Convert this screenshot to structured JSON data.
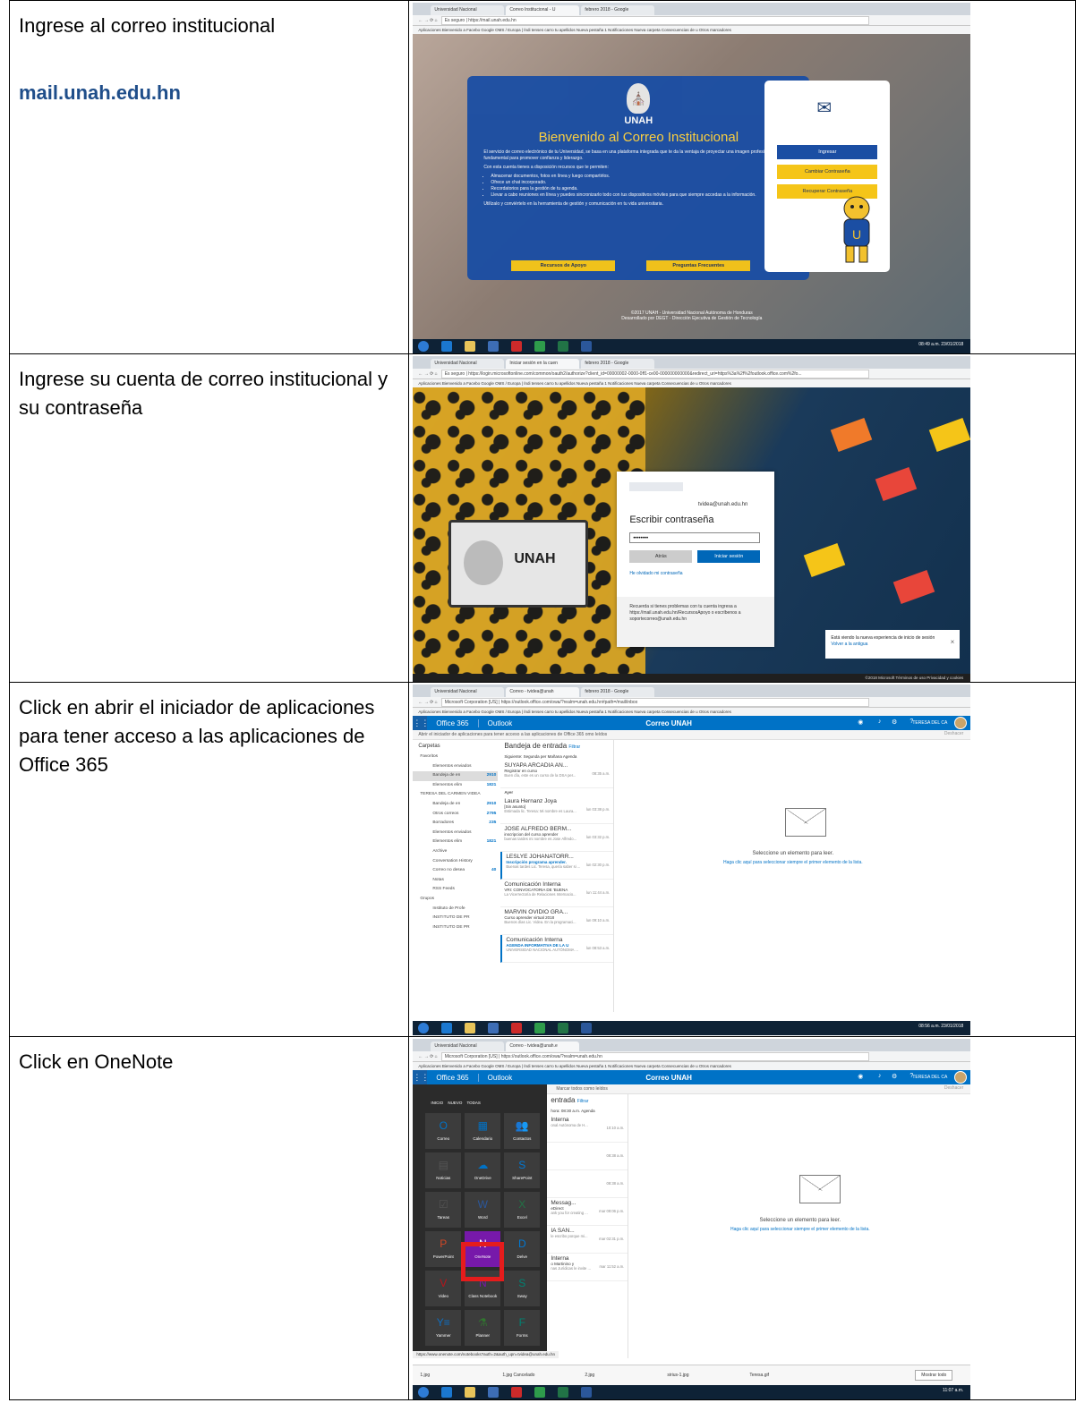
{
  "rows": [
    {
      "instruction": "Ingrese al correo institucional",
      "url_text": "mail.unah.edu.hn",
      "shot": {
        "tabs": [
          "Universidad Nacional",
          "Correo Institucional - U",
          "febrero 2018 - Google"
        ],
        "address": "Es seguro | https://mail.unah.edu.hn",
        "bookmarks": "Aplicaciones  Bienvenido a Facebo  Google  OMS / Europa | Índi  tenses  carro  tu apellidos  Nueva pestaña  1 Notificaciones  Nueva carpeta  Consecuencias de u  Otros marcadores",
        "seal_name": "UNAH",
        "title": "Bienvenido al Correo Institucional",
        "intro": "El servicio de correo electrónico de tu Universidad, se basa en una plataforma integrada que te da la ventaja de proyectar una imagen profesional, fundamental para promover confianza y liderazgo.",
        "list_intro": "Con esta cuenta tienes a disposición recursos que te permiten:",
        "bullets": [
          "Almacenar documentos, fotos en línea y luego compartirlos.",
          "Ofrece un chat incorporado.",
          "Recordatorios para la gestión de tu agenda.",
          "Llevar a cabo reuniones en línea y puedes sincronizarlo todo con tus dispositivos móviles para que siempre accedas a la información."
        ],
        "closing": "Utilízalo y conviértelo en la herramienta de gestión y comunicación en tu vida universitaria.",
        "btn_resources": "Recursos de Apoyo",
        "btn_faq": "Preguntas Frecuentes",
        "btn_login": "Ingresar",
        "btn_change": "Cambiar Contraseña",
        "btn_recover": "Recuperar Contraseña",
        "footer_1": "©2017 UNAH - Universidad Nacional Autónoma de Honduras",
        "footer_2": "Desarrollado por DEGT - Dirección Ejecutiva de Gestión de Tecnología",
        "clock": "08:49 a.m. 23/01/2018"
      }
    },
    {
      "instruction": "Ingrese su cuenta de correo institucional y su contraseña",
      "shot": {
        "tabs": [
          "Universidad Nacional",
          "Iniciar sesión en la cuen",
          "febrero 2018 - Google"
        ],
        "address": "Es seguro | https://login.microsoftonline.com/common/oauth2/authorize?client_id=00000002-0000-0ff1-ce00-000000000000&redirect_uri=https%3a%2f%2foutlook.office.com%2fo...",
        "bookmarks": "Aplicaciones  Bienvenido a Facebo  Google  OMS / Europa | Índi  tenses  carro  tu apellidos  Nueva pestaña  1 Notificaciones  Nueva carpeta  Consecuencias de u  Otros marcadores",
        "laptop_label": "UNAH",
        "email": "tvidea@unah.edu.hn",
        "heading": "Escribir contraseña",
        "password": "••••••••",
        "btn_back": "Atrás",
        "btn_signin": "Iniciar sesión",
        "forgot": "He olvidado mi contraseña",
        "note": "Recuerda si tienes problemas con tu cuenta ingresa a https://mail.unah.edu.hn/RecursosApoyo o escríbenos a soportecorreo@unah.edu.hn",
        "toast_1": "Está viendo la nueva experiencia de inicio de sesión",
        "toast_2": "Volver a la antigua",
        "footer": "©2018 Microsoft    Términos de uso    Privacidad y cookies"
      }
    },
    {
      "instruction": "Click en abrir el iniciador de aplicaciones para tener acceso a las aplicaciones de Office 365",
      "shot": {
        "tabs": [
          "Universidad Nacional",
          "Correo - tvidea@unah",
          "febrero 2018 - Google"
        ],
        "address": "Microsoft Corporation [US] | https://outlook.office.com/owa/?realm=unah.edu.hn#path=/mail/inbox",
        "bookmarks": "Aplicaciones  Bienvenido a Facebo  Google  OMS / Europa | Índi  tenses  carro  tu apellidos  Nueva pestaña  1 Notificaciones  Nueva carpeta  Consecuencias de u  Otros marcadores",
        "brand": "Office 365",
        "app": "Outlook",
        "center": "Correo UNAH",
        "user": "TERESA DEL CA",
        "tooltip": "Abrir el iniciador de aplicaciones para tener acceso a las aplicaciones de Office 365 omo leídos",
        "undo": "Deshacer",
        "folders": [
          {
            "label": "Carpetas",
            "count": "",
            "cls": "top"
          },
          {
            "label": "Favoritos",
            "count": "",
            "cls": "head"
          },
          {
            "label": "Elementos enviados",
            "count": "",
            "cls": ""
          },
          {
            "label": "Bandeja de en",
            "count": "2910",
            "cls": "sel"
          },
          {
            "label": "Elementos elim",
            "count": "1821",
            "cls": ""
          },
          {
            "label": "TERESA DEL CARMEN VIDEA",
            "count": "",
            "cls": "head"
          },
          {
            "label": "Bandeja de en",
            "count": "2910",
            "cls": ""
          },
          {
            "label": "Otros correos",
            "count": "2795",
            "cls": ""
          },
          {
            "label": "Borradores",
            "count": "235",
            "cls": ""
          },
          {
            "label": "Elementos enviados",
            "count": "",
            "cls": ""
          },
          {
            "label": "Elementos elim",
            "count": "1821",
            "cls": ""
          },
          {
            "label": "Archive",
            "count": "",
            "cls": ""
          },
          {
            "label": "Conversation History",
            "count": "",
            "cls": ""
          },
          {
            "label": "Correo no desea",
            "count": "40",
            "cls": ""
          },
          {
            "label": "Notas",
            "count": "",
            "cls": ""
          },
          {
            "label": "RSS Feeds",
            "count": "",
            "cls": ""
          },
          {
            "label": "Grupos",
            "count": "",
            "cls": "head"
          },
          {
            "label": "Instituto de Profe",
            "count": "",
            "cls": ""
          },
          {
            "label": "INSTITUTO DE PR",
            "count": "",
            "cls": ""
          },
          {
            "label": "INSTITUTO DE PR",
            "count": "",
            "cls": ""
          }
        ],
        "list_title": "Bandeja de entrada",
        "filter": "Filtrar",
        "list_sub": "Siguiente: Segunda per    Mañana  Agenda",
        "day_label": "Ayer",
        "mails": [
          {
            "from": "SUYAPA ARCADIA AN...",
            "subj": "Registrar en curso",
            "prev": "Buen día, este es un curso de la DSA per...",
            "when": "08:35 a.m.",
            "unread": false
          },
          {
            "from": "Laura Hernanz Joya",
            "subj": "[Sin asunto]",
            "prev": "Estimada lic. Teresa:  Mi nombre es Laura...",
            "when": "lun 03:38 p.m.",
            "unread": false
          },
          {
            "from": "JOSE ALFREDO BERM...",
            "subj": "inscripcion del curso aprender",
            "prev": "buenas tardes mi nombre es Jose Alfredo...",
            "when": "lun 03:32 p.m.",
            "unread": false
          },
          {
            "from": "LESLYE JOHANATORR...",
            "subj": "Inscripción programa aprender.",
            "prev": "Buenas tardes Lic. Teresa, quería saber si ...",
            "when": "lun 02:30 p.m.",
            "unread": true
          },
          {
            "from": "Comunicación Interna",
            "subj": "VRI: CONVOCATORIA DE 'BUENA",
            "prev": "La Vicerrectoría de Relaciones Internacio...",
            "when": "lun 11:44 a.m.",
            "unread": false
          },
          {
            "from": "MARVIN OVIDIO GRA...",
            "subj": "Curso aprender virtual 2018",
            "prev": "Buenos días Lic. Videa. En la programaci...",
            "when": "lun 09:10 a.m.",
            "unread": false
          },
          {
            "from": "Comunicación Interna",
            "subj": "AGENDA INFORMATIVA DE LA U",
            "prev": "UNIVERSIDAD NACIONAL AUTÓNOMA ...",
            "when": "lun 08:53 a.m.",
            "unread": true
          }
        ],
        "read_msg_1": "Seleccione un elemento para leer.",
        "read_msg_2": "Haga clic aquí para seleccionar siempre el primer elemento de la lista.",
        "clock": "08:56 a.m. 23/01/2018"
      }
    },
    {
      "instruction": "Click en OneNote",
      "shot": {
        "tabs": [
          "Universidad Nacional",
          "Correo - tvidea@unah.e"
        ],
        "address": "Microsoft Corporation [US] | https://outlook.office.com/owa/?realm=unah.edu.hn",
        "bookmarks": "Aplicaciones  Bienvenido a Facebo  Google  OMS / Europa | Índi  tenses  carro  tu apellidos  Nueva pestaña  1 Notificaciones  Nueva carpeta  Consecuencias de u  Otros marcadores",
        "brand": "Office 365",
        "app": "Outlook",
        "center": "Correo UNAH",
        "user": "TERESA DEL CA",
        "mark_all": "Marcar todos como leídos",
        "undo": "Deshacer",
        "launcher_tabs": "INICIO  NUEVO  TODAS",
        "tiles": [
          {
            "label": "Correo",
            "glyph": "O",
            "color": "#0072c6"
          },
          {
            "label": "Calendario",
            "glyph": "▦",
            "color": "#0072c6"
          },
          {
            "label": "Contactos",
            "glyph": "👥",
            "color": "#0072c6"
          },
          {
            "label": "Noticias",
            "glyph": "▤",
            "color": "#555"
          },
          {
            "label": "OneDrive",
            "glyph": "☁",
            "color": "#0072c6"
          },
          {
            "label": "SharePoint",
            "glyph": "S",
            "color": "#0078d4"
          },
          {
            "label": "Tareas",
            "glyph": "☑",
            "color": "#555"
          },
          {
            "label": "Word",
            "glyph": "W",
            "color": "#2b579a"
          },
          {
            "label": "Excel",
            "glyph": "X",
            "color": "#217346"
          },
          {
            "label": "PowerPoint",
            "glyph": "P",
            "color": "#d24726"
          },
          {
            "label": "OneNote",
            "glyph": "N",
            "color": "#7719aa"
          },
          {
            "label": "Delve",
            "glyph": "D",
            "color": "#0078d4"
          },
          {
            "label": "Video",
            "glyph": "V",
            "color": "#ba141a"
          },
          {
            "label": "Class Notebook",
            "glyph": "N",
            "color": "#7719aa"
          },
          {
            "label": "Sway",
            "glyph": "S",
            "color": "#008272"
          },
          {
            "label": "Yammer",
            "glyph": "Y≡",
            "color": "#106ebe"
          },
          {
            "label": "Planner",
            "glyph": "⚗",
            "color": "#31752f"
          },
          {
            "label": "Forms",
            "glyph": "F",
            "color": "#008272"
          }
        ],
        "list_title": "entrada",
        "filter": "Filtrar",
        "list_sub": "hora: 08:30 a.m.  Agenda",
        "mails": [
          {
            "from": "Interna",
            "subj": "",
            "prev": "onal Autónoma de H...",
            "when": "10:10 a.m.",
            "unread": false
          },
          {
            "from": "",
            "subj": "",
            "prev": "",
            "when": "08:38 a.m.",
            "unread": false
          },
          {
            "from": "",
            "subj": "",
            "prev": "",
            "when": "08:38 a.m.",
            "unread": false
          },
          {
            "from": "Messag...",
            "subj": "eDirect",
            "prev": "ank you for creating ...",
            "when": "mar 09:06 p.m.",
            "unread": false
          },
          {
            "from": "IA SAN...",
            "subj": "",
            "prev": "le escribo porque mi...",
            "when": "mar 02:31 p.m.",
            "unread": false
          },
          {
            "from": "Interna",
            "subj": "o Martinino y",
            "prev": "nas Jurídicas le invite ...",
            "when": "mar 11:52 a.m.",
            "unread": false
          }
        ],
        "read_msg_1": "Seleccione un elemento para leer.",
        "read_msg_2": "Haga clic aquí para seleccionar siempre el primer elemento de la lista.",
        "status_url": "https://www.onenote.com/notebooks?auth=2&auth_upn=tvidea@unah.edu.hn",
        "downloads": [
          "1.jpg",
          "1.jpg Cancelado",
          "2.jpg",
          "sirius-1.jpg",
          "Teresa.gif"
        ],
        "show_all": "Mostrar todo",
        "clock": "11:07 a.m."
      }
    }
  ]
}
